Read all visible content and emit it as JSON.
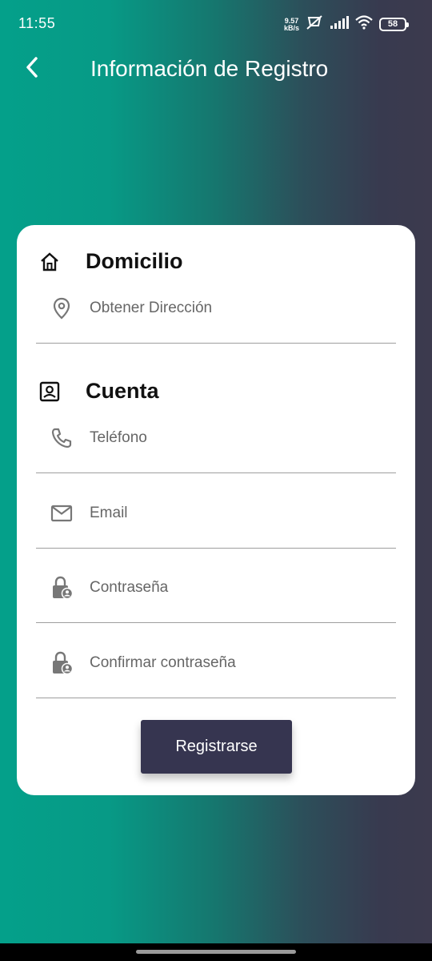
{
  "status_bar": {
    "time": "11:55",
    "net_speed_value": "9.57",
    "net_speed_unit": "kB/s",
    "battery": "58"
  },
  "app_bar": {
    "title": "Información de Registro"
  },
  "domicilio": {
    "title": "Domicilio",
    "address_placeholder": "Obtener Dirección"
  },
  "cuenta": {
    "title": "Cuenta",
    "phone_placeholder": "Teléfono",
    "email_placeholder": "Email",
    "password_placeholder": "Contraseña",
    "confirm_password_placeholder": "Confirmar contraseña"
  },
  "actions": {
    "register_label": "Registrarse"
  },
  "colors": {
    "gradient_start": "#04a08a",
    "gradient_end": "#3c3a4e",
    "button": "#363550"
  }
}
